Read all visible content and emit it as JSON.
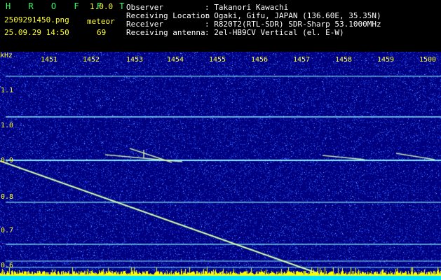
{
  "app": {
    "logo": "H R O F F T",
    "version": "1.0.0",
    "filename": "2509291450.png",
    "datetime": "25.09.29 14:50",
    "meteor_label": "meteor",
    "meteor_count": "69"
  },
  "info": {
    "observer_label": "Observer",
    "observer_value": ": Takanori Kawachi",
    "location_label": "Receiving Location",
    "location_value": ": Ogaki, Gifu, JAPAN (136.60E, 35.35N)",
    "receiver_label": "Receiver",
    "receiver_value": ": R820T2(RTL-SDR) SDR-Sharp 53.1000MHz",
    "antenna_label": "Receiving antenna",
    "antenna_value": ": 2el-HB9CV Vertical (el. E-W)"
  },
  "spectrogram": {
    "unit_label": "kHz",
    "time_labels": [
      "1451",
      "1452",
      "1453",
      "1454",
      "1455",
      "1456",
      "1457",
      "1458",
      "1459",
      "1500"
    ],
    "freq_labels": [
      "1.1",
      "1.0",
      "0.9",
      "0.8",
      "0.7",
      "0.6"
    ],
    "colors": {
      "background": "#000080",
      "noise": "#2a5cff",
      "carrier": "#8ce8ff",
      "echo": "#d8ffb0",
      "tick_text": "#ffff33",
      "amplitude": "#ffff00",
      "baseline": "#00e5ff"
    }
  }
}
